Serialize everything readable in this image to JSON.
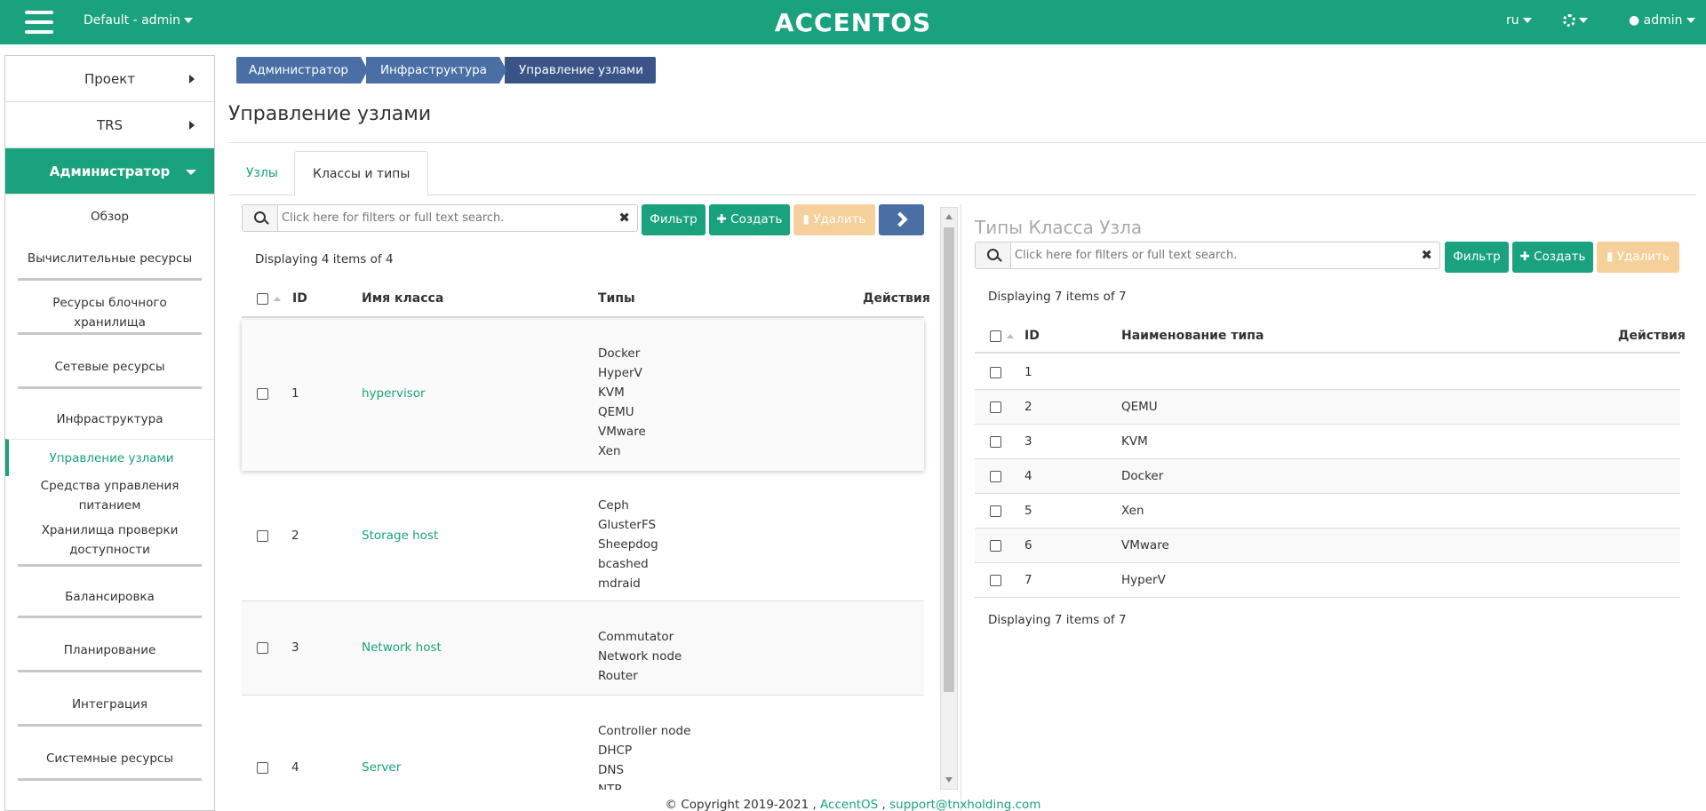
{
  "header": {
    "project": "Default - admin",
    "logo": "ACCENTOS",
    "lang": "ru",
    "user": "admin",
    "menu_icon": "hamburger-icon",
    "settings_icon": "gear-icon",
    "user_icon": "user-icon"
  },
  "sidebar": {
    "sections": [
      {
        "label": "Проект"
      },
      {
        "label": "TRS"
      },
      {
        "label": "Администратор"
      }
    ],
    "items": [
      "Обзор",
      "Вычислительные ресурсы",
      "Ресурсы блочного хранилища",
      "Сетевые ресурсы",
      "Инфраструктура",
      "Управление узлами",
      "Средства управления питанием",
      "Хранилища проверки доступности",
      "Балансировка",
      "Планирование",
      "Интеграция",
      "Системные ресурсы"
    ]
  },
  "breadcrumb": [
    "Администратор",
    "Инфраструктура",
    "Управление узлами"
  ],
  "page_title": "Управление узлами",
  "tabs": [
    "Узлы",
    "Классы и типы"
  ],
  "left": {
    "search_placeholder": "Click here for filters or full text search.",
    "filter": "Фильтр",
    "create": "Создать",
    "delete": "Удалить",
    "info": "Displaying 4 items of 4",
    "columns": [
      "ID",
      "Имя класса",
      "Типы",
      "Действия"
    ],
    "rows": [
      {
        "id": "1",
        "name": "hypervisor",
        "types": [
          "Docker",
          "HyperV",
          "KVM",
          "QEMU",
          "VMware",
          "Xen"
        ]
      },
      {
        "id": "2",
        "name": "Storage host",
        "types": [
          "Ceph",
          "GlusterFS",
          "Sheepdog",
          "bcashed",
          "mdraid"
        ]
      },
      {
        "id": "3",
        "name": "Network host",
        "types": [
          "Commutator",
          "Network node",
          "Router"
        ]
      },
      {
        "id": "4",
        "name": "Server",
        "types": [
          "Controller node",
          "DHCP",
          "DNS",
          "NTP"
        ]
      }
    ]
  },
  "right": {
    "title": "Типы Класса Узла",
    "search_placeholder": "Click here for filters or full text search.",
    "filter": "Фильтр",
    "create": "Создать",
    "delete": "Удалить",
    "info": "Displaying 7 items of 7",
    "info_bottom": "Displaying 7 items of 7",
    "columns": [
      "ID",
      "Наименование типа",
      "Действия"
    ],
    "rows": [
      {
        "id": "1",
        "name": ""
      },
      {
        "id": "2",
        "name": "QEMU"
      },
      {
        "id": "3",
        "name": "KVM"
      },
      {
        "id": "4",
        "name": "Docker"
      },
      {
        "id": "5",
        "name": "Xen"
      },
      {
        "id": "6",
        "name": "VMware"
      },
      {
        "id": "7",
        "name": "HyperV"
      }
    ]
  },
  "footer": {
    "copyright": "© Copyright 2019-2021 ,",
    "brand": "AccentOS",
    "sep": ",",
    "email": "support@tnxholding.com"
  },
  "colors": {
    "accent": "#19a27d",
    "crumb": "#4a6fa5",
    "danger_disabled": "#f5d09b"
  }
}
